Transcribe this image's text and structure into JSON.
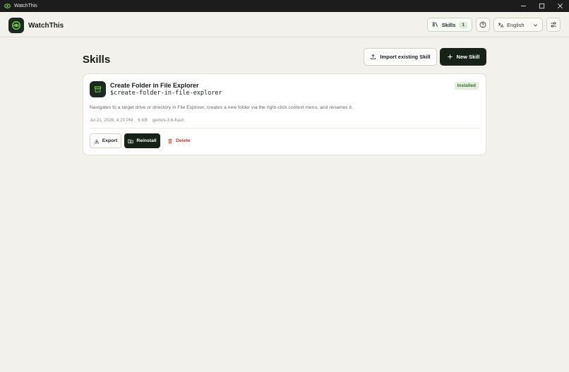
{
  "window": {
    "title": "WatchThis"
  },
  "header": {
    "brand": "WatchThis",
    "skills_label": "Skills",
    "skills_count": "1",
    "language": "English"
  },
  "main": {
    "title": "Skills",
    "import_label": "Import existing Skill",
    "new_label": "New Skill"
  },
  "skill": {
    "name": "Create Folder in File Explorer",
    "slug": "$create-folder-in-file-explorer",
    "status": "Installed",
    "description": "Navigates to a target drive or directory in File Explorer, creates a new folder via the right-click context menu, and renames it.",
    "date": "Jul 21, 2026, 4:20 PM",
    "size": "6 KB",
    "model": "gemini-3.6-flash",
    "export_label": "Export",
    "reinstall_label": "Reinstall",
    "delete_label": "Delete"
  },
  "colors": {
    "accent_dark": "#162118",
    "brand_green": "#7fd650",
    "background": "#f3f1ec",
    "installed_bg": "#e3eedd",
    "installed_text": "#3b6b33",
    "danger": "#c0392b"
  },
  "icons": {
    "app": "eye-logo-icon",
    "skills": "library-icon",
    "help": "help-circle-icon",
    "language": "translate-icon",
    "dropdown": "chevron-down-icon",
    "settings": "sliders-icon",
    "import": "upload-icon",
    "new": "plus-icon",
    "skill": "archive-box-icon",
    "export": "download-icon",
    "reinstall": "folder-reinstall-icon",
    "delete": "trash-icon"
  }
}
